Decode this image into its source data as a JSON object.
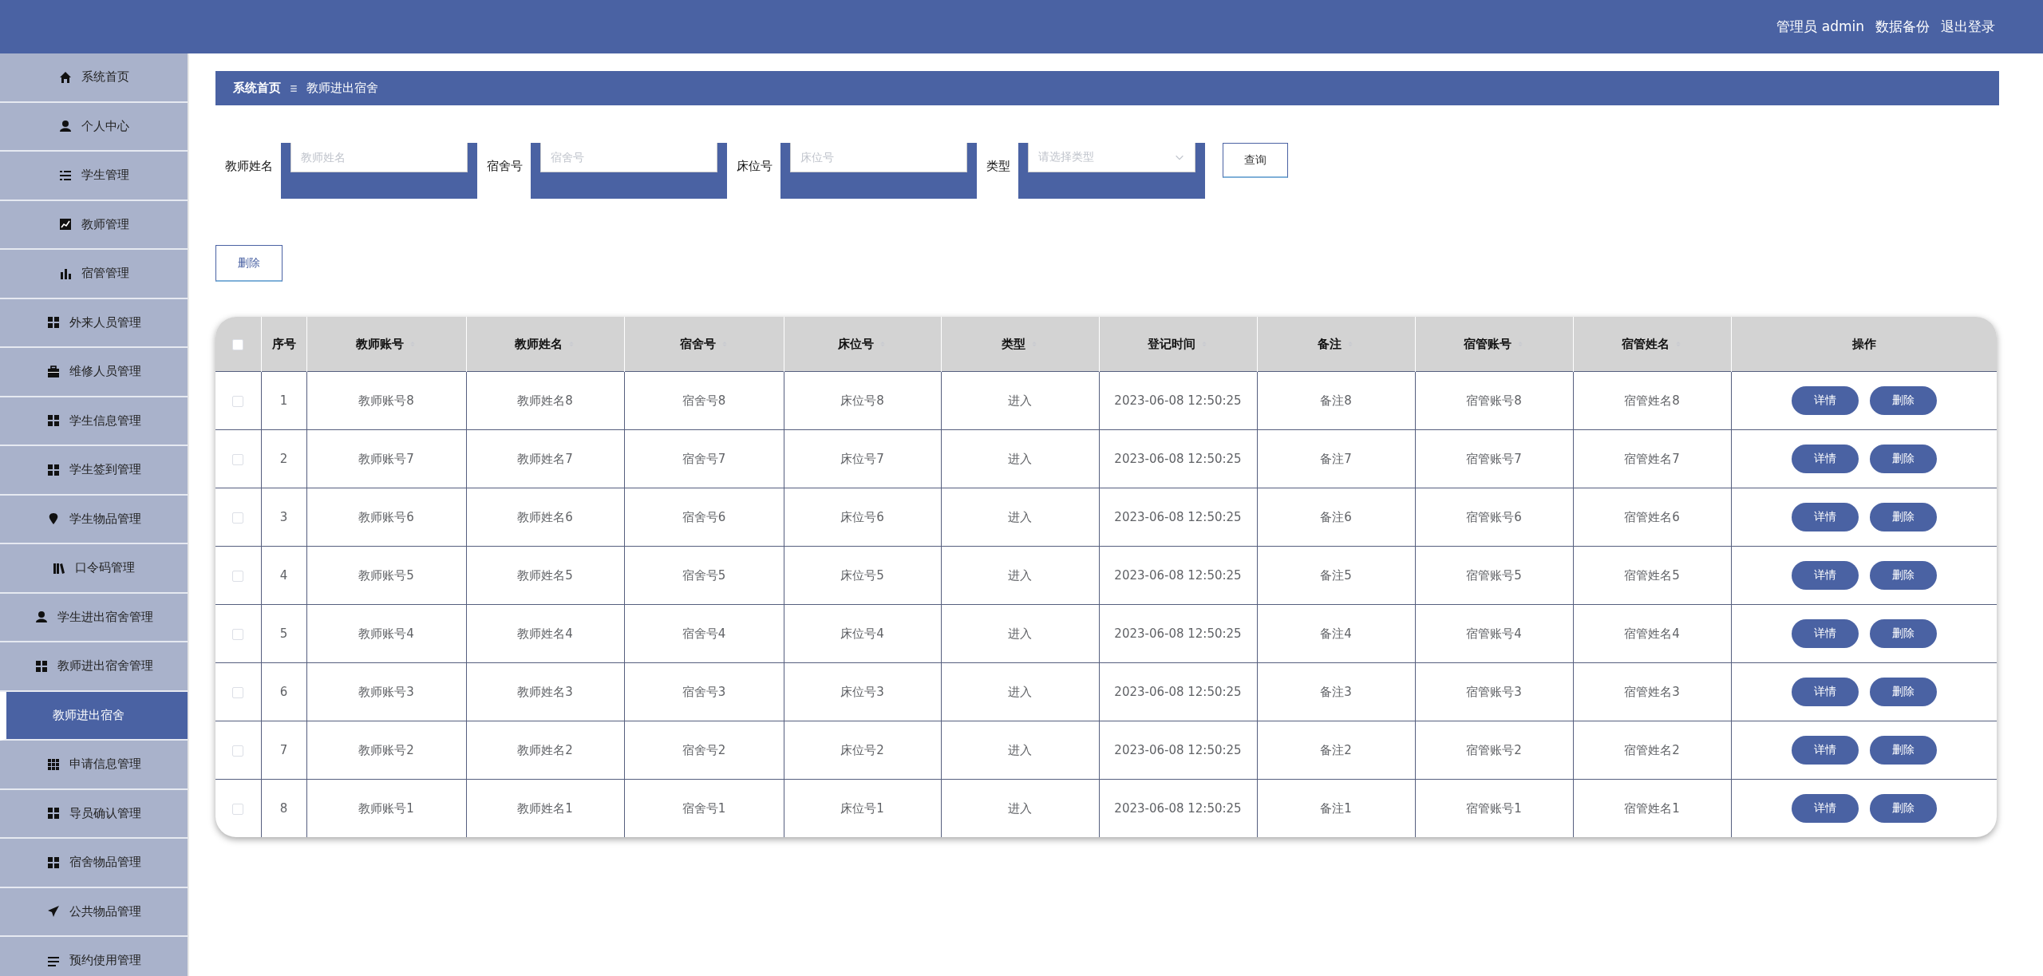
{
  "header": {
    "user": "管理员 admin",
    "links": [
      "数据备份",
      "退出登录"
    ]
  },
  "sidebar": {
    "items": [
      {
        "label": "系统首页",
        "selected": false
      },
      {
        "label": "个人中心",
        "selected": false
      },
      {
        "label": "学生管理",
        "selected": false
      },
      {
        "label": "教师管理",
        "selected": false
      },
      {
        "label": "宿管管理",
        "selected": false
      },
      {
        "label": "外来人员管理",
        "selected": false
      },
      {
        "label": "维修人员管理",
        "selected": false
      },
      {
        "label": "学生信息管理",
        "selected": false
      },
      {
        "label": "学生签到管理",
        "selected": false
      },
      {
        "label": "学生物品管理",
        "selected": false
      },
      {
        "label": "口令码管理",
        "selected": false
      },
      {
        "label": "学生进出宿舍管理",
        "selected": false
      },
      {
        "label": "教师进出宿舍管理",
        "selected": false
      },
      {
        "label": "教师进出宿舍",
        "selected": true
      },
      {
        "label": "申请信息管理",
        "selected": false
      },
      {
        "label": "导员确认管理",
        "selected": false
      },
      {
        "label": "宿舍物品管理",
        "selected": false
      },
      {
        "label": "公共物品管理",
        "selected": false
      },
      {
        "label": "预约使用管理",
        "selected": false
      }
    ]
  },
  "breadcrumb": [
    "系统首页",
    "教师进出宿舍"
  ],
  "search": {
    "fields": [
      {
        "kind": "text",
        "label": "教师姓名",
        "placeholder": "教师姓名"
      },
      {
        "kind": "text",
        "label": "宿舍号",
        "placeholder": "宿舍号"
      },
      {
        "kind": "text",
        "label": "床位号",
        "placeholder": "床位号"
      },
      {
        "kind": "select",
        "label": "类型",
        "placeholder": "请选择类型"
      }
    ],
    "button": "查询"
  },
  "delete_button": "删除",
  "table": {
    "select_all_checked": false,
    "columns": [
      {
        "label": "序号",
        "sortable": false
      },
      {
        "label": "教师账号",
        "sortable": true
      },
      {
        "label": "教师姓名",
        "sortable": true
      },
      {
        "label": "宿舍号",
        "sortable": true
      },
      {
        "label": "床位号",
        "sortable": true
      },
      {
        "label": "类型",
        "sortable": true
      },
      {
        "label": "登记时间",
        "sortable": true
      },
      {
        "label": "备注",
        "sortable": true
      },
      {
        "label": "宿管账号",
        "sortable": true
      },
      {
        "label": "宿管姓名",
        "sortable": true
      },
      {
        "label": "操作",
        "sortable": false
      }
    ],
    "rows": [
      {
        "checked": false,
        "cells": [
          "1",
          "教师账号8",
          "教师姓名8",
          "宿舍号8",
          "床位号8",
          "进入",
          "2023-06-08 12:50:25",
          "备注8",
          "宿管账号8",
          "宿管姓名8"
        ],
        "actions": [
          "详情",
          "删除"
        ]
      },
      {
        "checked": false,
        "cells": [
          "2",
          "教师账号7",
          "教师姓名7",
          "宿舍号7",
          "床位号7",
          "进入",
          "2023-06-08 12:50:25",
          "备注7",
          "宿管账号7",
          "宿管姓名7"
        ],
        "actions": [
          "详情",
          "删除"
        ]
      },
      {
        "checked": false,
        "cells": [
          "3",
          "教师账号6",
          "教师姓名6",
          "宿舍号6",
          "床位号6",
          "进入",
          "2023-06-08 12:50:25",
          "备注6",
          "宿管账号6",
          "宿管姓名6"
        ],
        "actions": [
          "详情",
          "删除"
        ]
      },
      {
        "checked": false,
        "cells": [
          "4",
          "教师账号5",
          "教师姓名5",
          "宿舍号5",
          "床位号5",
          "进入",
          "2023-06-08 12:50:25",
          "备注5",
          "宿管账号5",
          "宿管姓名5"
        ],
        "actions": [
          "详情",
          "删除"
        ]
      },
      {
        "checked": false,
        "cells": [
          "5",
          "教师账号4",
          "教师姓名4",
          "宿舍号4",
          "床位号4",
          "进入",
          "2023-06-08 12:50:25",
          "备注4",
          "宿管账号4",
          "宿管姓名4"
        ],
        "actions": [
          "详情",
          "删除"
        ]
      },
      {
        "checked": false,
        "cells": [
          "6",
          "教师账号3",
          "教师姓名3",
          "宿舍号3",
          "床位号3",
          "进入",
          "2023-06-08 12:50:25",
          "备注3",
          "宿管账号3",
          "宿管姓名3"
        ],
        "actions": [
          "详情",
          "删除"
        ]
      },
      {
        "checked": false,
        "cells": [
          "7",
          "教师账号2",
          "教师姓名2",
          "宿舍号2",
          "床位号2",
          "进入",
          "2023-06-08 12:50:25",
          "备注2",
          "宿管账号2",
          "宿管姓名2"
        ],
        "actions": [
          "详情",
          "删除"
        ]
      },
      {
        "checked": false,
        "cells": [
          "8",
          "教师账号1",
          "教师姓名1",
          "宿舍号1",
          "床位号1",
          "进入",
          "2023-06-08 12:50:25",
          "备注1",
          "宿管账号1",
          "宿管姓名1"
        ],
        "actions": [
          "详情",
          "删除"
        ]
      }
    ]
  }
}
